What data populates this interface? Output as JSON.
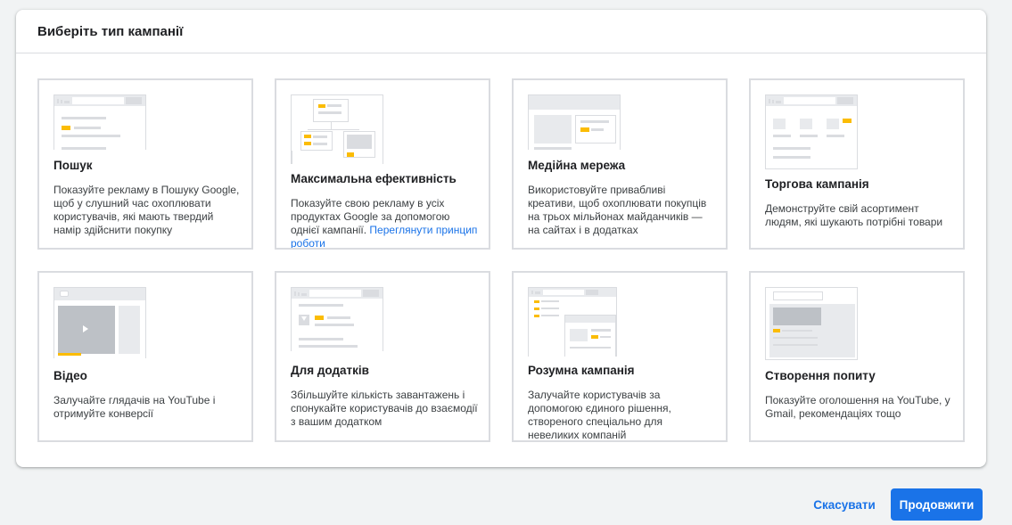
{
  "dialog": {
    "title": "Виберіть тип кампанії"
  },
  "cards": [
    {
      "title": "Пошук",
      "description": "Показуйте рекламу в Пошуку Google, щоб у слушний час охоплювати користувачів, які мають твердий намір здійснити покупку"
    },
    {
      "title": "Максимальна ефективність",
      "description": "Показуйте свою рекламу в усіх продуктах Google за допомогою однієї кампанії.",
      "link": "Переглянути принцип роботи"
    },
    {
      "title": "Медійна мережа",
      "description": "Використовуйте привабливі креативи, щоб охоплювати покупців на трьох мільйонах майданчиків — на сайтах і в додатках"
    },
    {
      "title": "Торгова кампанія",
      "description": "Демонструйте свій асортимент людям, які шукають потрібні товари"
    },
    {
      "title": "Відео",
      "description": "Залучайте глядачів на YouTube і отримуйте конверсії"
    },
    {
      "title": "Для додатків",
      "description": "Збільшуйте кількість завантажень і спонукайте користувачів до взаємодії з вашим додатком"
    },
    {
      "title": "Розумна кампанія",
      "description": "Залучайте користувачів за допомогою єдиного рішення, створеного спеціально для невеликих компаній"
    },
    {
      "title": "Створення попиту",
      "description": "Показуйте оголошення на YouTube, у Gmail, рекомендаціях тощо"
    }
  ],
  "footer": {
    "cancel_label": "Скасувати",
    "continue_label": "Продовжити"
  },
  "colors": {
    "accent": "#1a73e8",
    "highlight": "#fbbc04",
    "border": "#dadce0"
  }
}
